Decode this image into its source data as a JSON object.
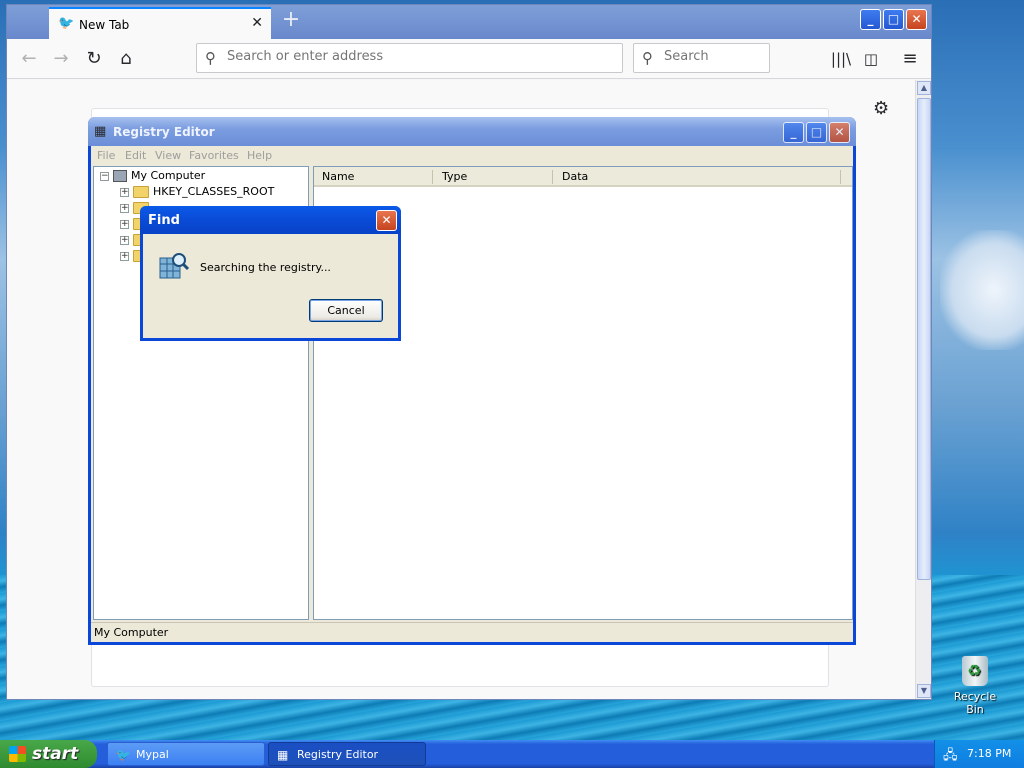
{
  "desktop": {
    "recycle_bin_label": "Recycle Bin"
  },
  "browser": {
    "tab_title": "New Tab",
    "new_tab_symbol": "+",
    "url_placeholder": "Search or enter address",
    "search_placeholder": "Search",
    "window_buttons": {
      "minimize": "_",
      "maximize": "□",
      "close": "✕"
    }
  },
  "registry_editor": {
    "title": "Registry Editor",
    "menu": [
      "File",
      "Edit",
      "View",
      "Favorites",
      "Help"
    ],
    "tree": {
      "root": "My Computer",
      "items": [
        "HKEY_CLASSES_ROOT"
      ]
    },
    "columns": [
      "Name",
      "Type",
      "Data"
    ],
    "status": "My Computer"
  },
  "find_dialog": {
    "title": "Find",
    "message": "Searching the registry...",
    "cancel_label": "Cancel",
    "close_symbol": "✕"
  },
  "taskbar": {
    "start_label": "start",
    "buttons": [
      {
        "label": "Mypal",
        "active": false
      },
      {
        "label": "Registry Editor",
        "active": true
      }
    ],
    "clock": "7:18 PM"
  },
  "colors": {
    "xp_blue": "#0a46d8",
    "taskbar_blue": "#245edb",
    "start_green": "#3c9a3c",
    "firefox_accent": "#0a84ff"
  },
  "icons": {
    "browser_back": "arrow-left-icon",
    "browser_forward": "arrow-right-icon",
    "browser_reload": "reload-icon",
    "browser_home": "home-icon",
    "library": "library-icon",
    "sidebar": "sidebar-icon",
    "menu": "hamburger-menu-icon",
    "settings": "gear-icon"
  }
}
